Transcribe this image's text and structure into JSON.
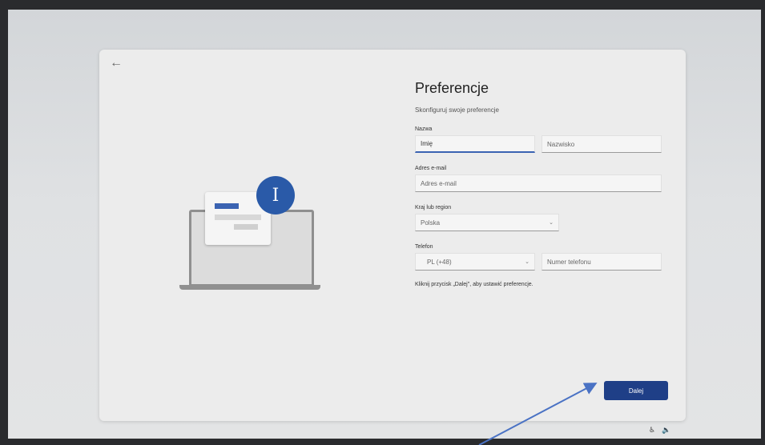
{
  "page": {
    "back_icon": "arrow-left-icon",
    "title": "Preferencje",
    "subtitle": "Skonfiguruj swoje preferencje"
  },
  "form": {
    "name_label": "Nazwa",
    "first_name_placeholder": "Imię",
    "last_name_placeholder": "Nazwisko",
    "email_label": "Adres e-mail",
    "email_placeholder": "Adres e-mail",
    "country_label": "Kraj lub region",
    "country_value": "Polska",
    "phone_label": "Telefon",
    "phone_prefix_value": "PL (+48)",
    "phone_placeholder": "Numer telefonu",
    "hint": "Kliknij przycisk „Dalej\", aby ustawić preferencje."
  },
  "actions": {
    "next_label": "Dalej"
  },
  "illustration": {
    "bubble_glyph": "I"
  },
  "system": {
    "icons": [
      "accessibility-icon",
      "volume-icon"
    ]
  },
  "colors": {
    "accent": "#1f3f87",
    "bubble": "#2a5aa8",
    "annotation_arrow": "#4a72c4"
  }
}
